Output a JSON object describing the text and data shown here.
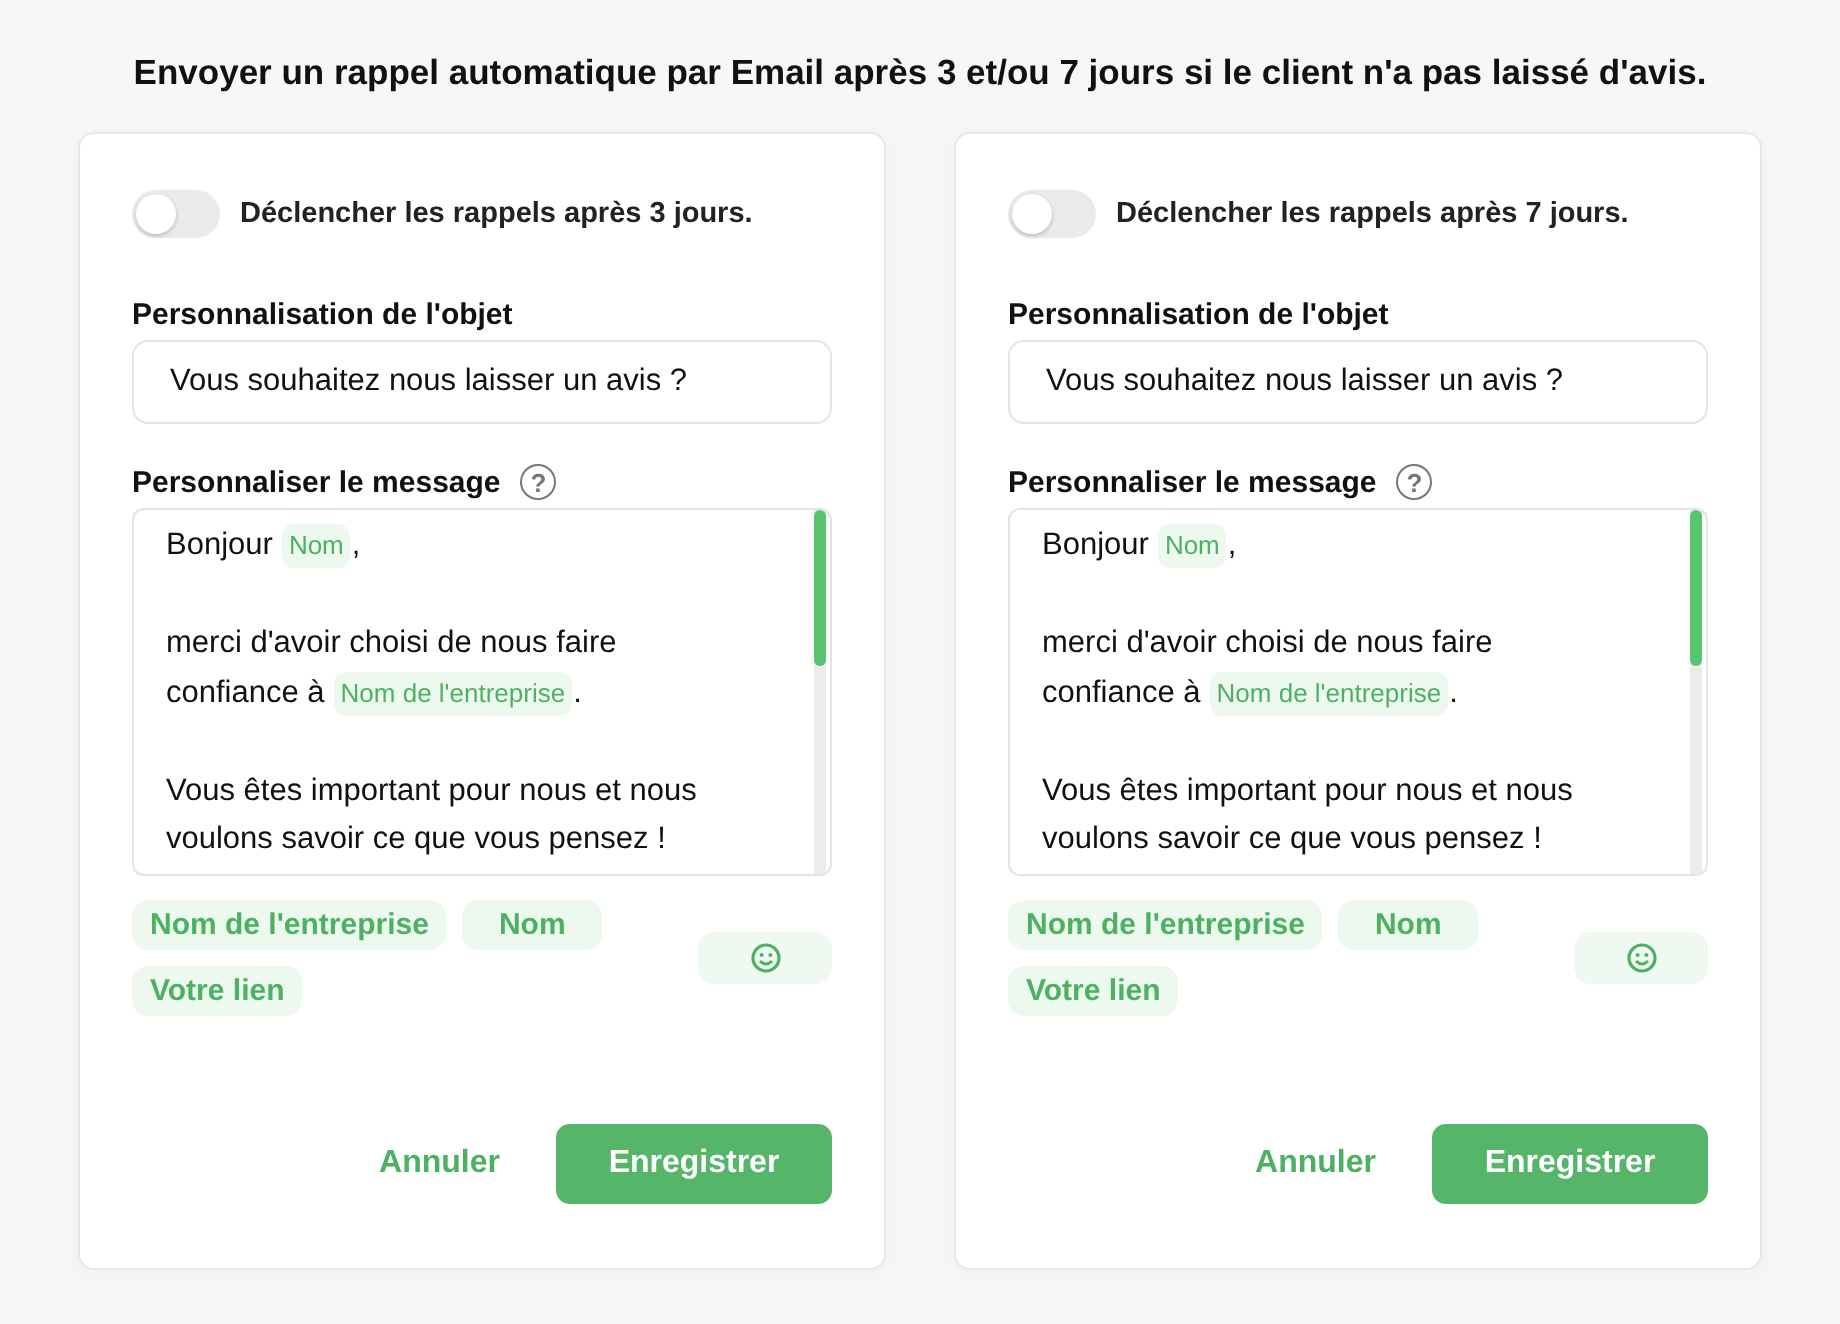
{
  "heading": "Envoyer un rappel automatique par Email après 3 et/ou 7 jours si le client n'a pas laissé d'avis.",
  "cards": [
    {
      "toggle": {
        "label": "Déclencher les rappels après 3 jours.",
        "on": false
      },
      "subject": {
        "label": "Personnalisation de l'objet",
        "value": "Vous souhaitez nous laisser un avis ?"
      },
      "message": {
        "label": "Personnaliser le message",
        "help_icon": "?",
        "paragraphs": [
          {
            "lines": [
              [
                {
                  "kind": "text",
                  "text": "Bonjour"
                },
                {
                  "kind": "tag",
                  "text": "Nom"
                },
                {
                  "kind": "text",
                  "text": ","
                }
              ]
            ]
          },
          {
            "lines": [
              [
                {
                  "kind": "text",
                  "text": "merci d'avoir choisi de nous faire"
                }
              ],
              [
                {
                  "kind": "text",
                  "text": "confiance à"
                },
                {
                  "kind": "tag",
                  "text": "Nom de l'entreprise"
                },
                {
                  "kind": "text",
                  "text": "."
                }
              ]
            ]
          },
          {
            "lines": [
              [
                {
                  "kind": "text",
                  "text": "Vous êtes important pour nous et nous"
                }
              ],
              [
                {
                  "kind": "text",
                  "text": "voulons savoir ce que vous pensez !"
                }
              ]
            ]
          }
        ]
      },
      "variables": [
        "Nom de l'entreprise",
        "Nom",
        "Votre lien"
      ],
      "cancel": "Annuler",
      "save": "Enregistrer"
    },
    {
      "toggle": {
        "label": "Déclencher les rappels après 7 jours.",
        "on": false
      },
      "subject": {
        "label": "Personnalisation de l'objet",
        "value": "Vous souhaitez nous laisser un avis ?"
      },
      "message": {
        "label": "Personnaliser le message",
        "help_icon": "?",
        "paragraphs": [
          {
            "lines": [
              [
                {
                  "kind": "text",
                  "text": "Bonjour"
                },
                {
                  "kind": "tag",
                  "text": "Nom"
                },
                {
                  "kind": "text",
                  "text": ","
                }
              ]
            ]
          },
          {
            "lines": [
              [
                {
                  "kind": "text",
                  "text": "merci d'avoir choisi de nous faire"
                }
              ],
              [
                {
                  "kind": "text",
                  "text": "confiance à"
                },
                {
                  "kind": "tag",
                  "text": "Nom de l'entreprise"
                },
                {
                  "kind": "text",
                  "text": "."
                }
              ]
            ]
          },
          {
            "lines": [
              [
                {
                  "kind": "text",
                  "text": "Vous êtes important pour nous et nous"
                }
              ],
              [
                {
                  "kind": "text",
                  "text": "voulons savoir ce que vous pensez !"
                }
              ]
            ]
          }
        ]
      },
      "variables": [
        "Nom de l'entreprise",
        "Nom",
        "Votre lien"
      ],
      "cancel": "Annuler",
      "save": "Enregistrer"
    }
  ]
}
